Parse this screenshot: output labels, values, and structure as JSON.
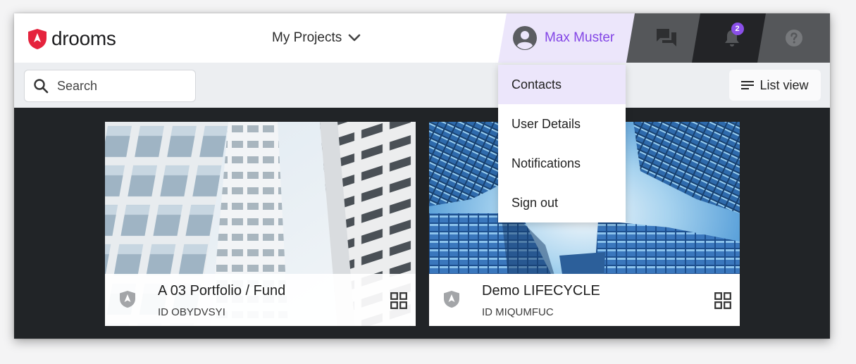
{
  "brand": {
    "name": "drooms"
  },
  "header": {
    "projects_label": "My Projects",
    "user_name": "Max Muster",
    "notification_count": "2"
  },
  "toolbar": {
    "search_placeholder": "Search",
    "list_view_label": "List view"
  },
  "user_menu": {
    "items": [
      {
        "label": "Contacts",
        "active": true
      },
      {
        "label": "User Details"
      },
      {
        "label": "Notifications"
      },
      {
        "label": "Sign out"
      }
    ]
  },
  "projects": [
    {
      "title": "A 03 Portfolio / Fund",
      "id": "ID OBYDVSYI"
    },
    {
      "title": "Demo LIFECYCLE",
      "id": "ID MIQUMFUC"
    }
  ],
  "colors": {
    "accent": "#8345e6",
    "brand_red": "#e5233d",
    "header_dark": "#232427",
    "header_grey": "#55575a"
  }
}
